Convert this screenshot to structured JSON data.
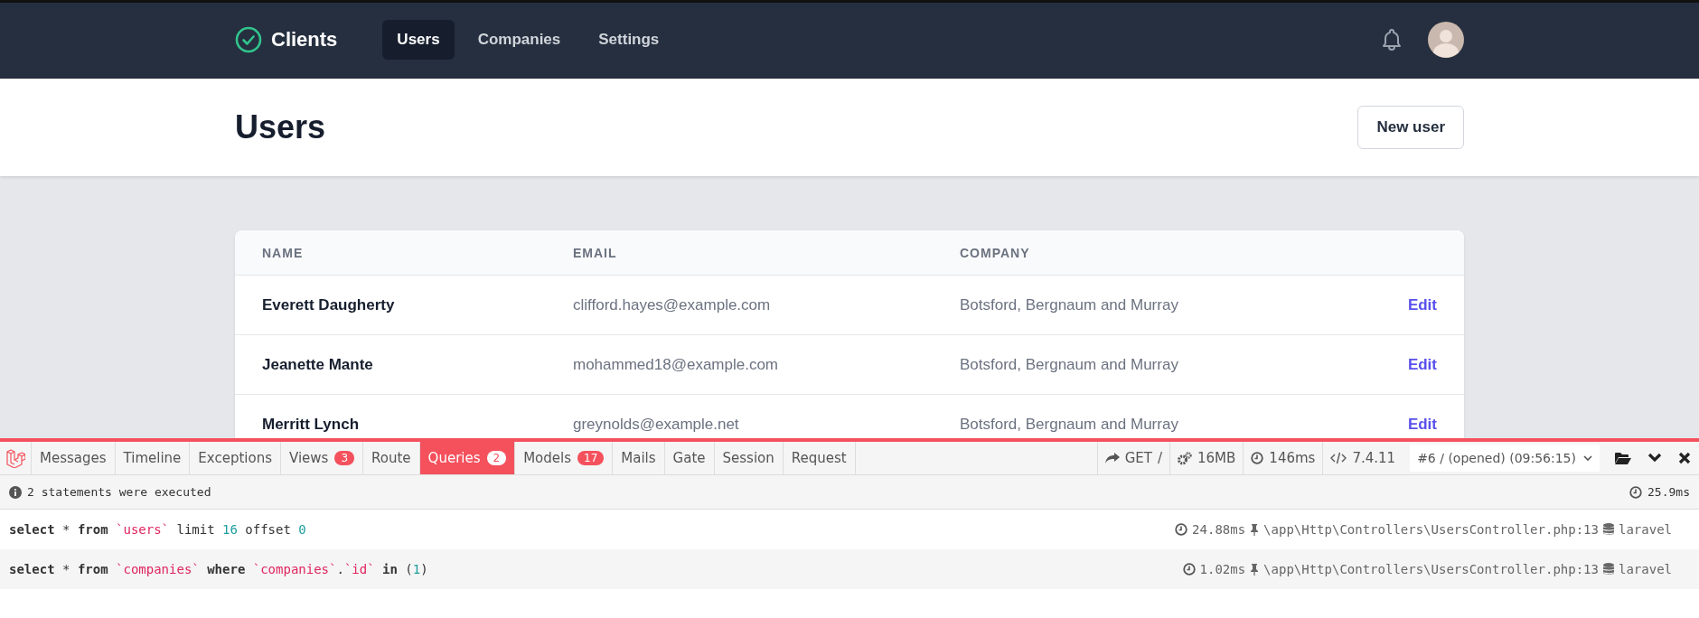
{
  "nav": {
    "brand": "Clients",
    "items": [
      {
        "label": "Users",
        "selected": true
      },
      {
        "label": "Companies",
        "selected": false
      },
      {
        "label": "Settings",
        "selected": false
      }
    ]
  },
  "header": {
    "title": "Users",
    "button": "New user"
  },
  "table": {
    "columns": [
      "NAME",
      "EMAIL",
      "COMPANY"
    ],
    "rows": [
      {
        "name": "Everett Daugherty",
        "email": "clifford.hayes@example.com",
        "company": "Botsford, Bergnaum and Murray",
        "action": "Edit"
      },
      {
        "name": "Jeanette Mante",
        "email": "mohammed18@example.com",
        "company": "Botsford, Bergnaum and Murray",
        "action": "Edit"
      },
      {
        "name": "Merritt Lynch",
        "email": "greynolds@example.net",
        "company": "Botsford, Bergnaum and Murray",
        "action": "Edit"
      }
    ]
  },
  "debugbar": {
    "tabs": [
      {
        "label": "Messages",
        "selected": false
      },
      {
        "label": "Timeline",
        "selected": false
      },
      {
        "label": "Exceptions",
        "selected": false
      },
      {
        "label": "Views",
        "badge": "3",
        "selected": false
      },
      {
        "label": "Route",
        "selected": false
      },
      {
        "label": "Queries",
        "badge": "2",
        "selected": true
      },
      {
        "label": "Models",
        "badge": "17",
        "selected": false
      },
      {
        "label": "Mails",
        "selected": false
      },
      {
        "label": "Gate",
        "selected": false
      },
      {
        "label": "Session",
        "selected": false
      },
      {
        "label": "Request",
        "selected": false
      }
    ],
    "method": "GET",
    "path": "/",
    "memory": "16MB",
    "duration": "146ms",
    "php_version": "7.4.11",
    "dataset": "#6 / (opened) (09:56:15)",
    "summary": "2 statements were executed",
    "total_time": "25.9ms",
    "queries": [
      {
        "tokens": [
          {
            "kind": "keyword",
            "text": "select"
          },
          {
            "kind": "plain",
            "text": " * "
          },
          {
            "kind": "keyword",
            "text": "from"
          },
          {
            "kind": "string",
            "text": " `users`"
          },
          {
            "kind": "plain",
            "text": " limit "
          },
          {
            "kind": "number",
            "text": "16"
          },
          {
            "kind": "plain",
            "text": " offset "
          },
          {
            "kind": "number",
            "text": "0"
          }
        ],
        "time": "24.88ms",
        "source": "\\app\\Http\\Controllers\\UsersController.php:13",
        "connection": "laravel"
      },
      {
        "tokens": [
          {
            "kind": "keyword",
            "text": "select"
          },
          {
            "kind": "plain",
            "text": " * "
          },
          {
            "kind": "keyword",
            "text": "from"
          },
          {
            "kind": "string",
            "text": " `companies`"
          },
          {
            "kind": "keyword",
            "text": " where "
          },
          {
            "kind": "string",
            "text": "`companies`"
          },
          {
            "kind": "plain",
            "text": "."
          },
          {
            "kind": "string",
            "text": "`id`"
          },
          {
            "kind": "keyword",
            "text": " in"
          },
          {
            "kind": "plain",
            "text": " ("
          },
          {
            "kind": "number",
            "text": "1"
          },
          {
            "kind": "plain",
            "text": ")"
          }
        ],
        "time": "1.02ms",
        "source": "\\app\\Http\\Controllers\\UsersController.php:13",
        "connection": "laravel"
      }
    ]
  }
}
